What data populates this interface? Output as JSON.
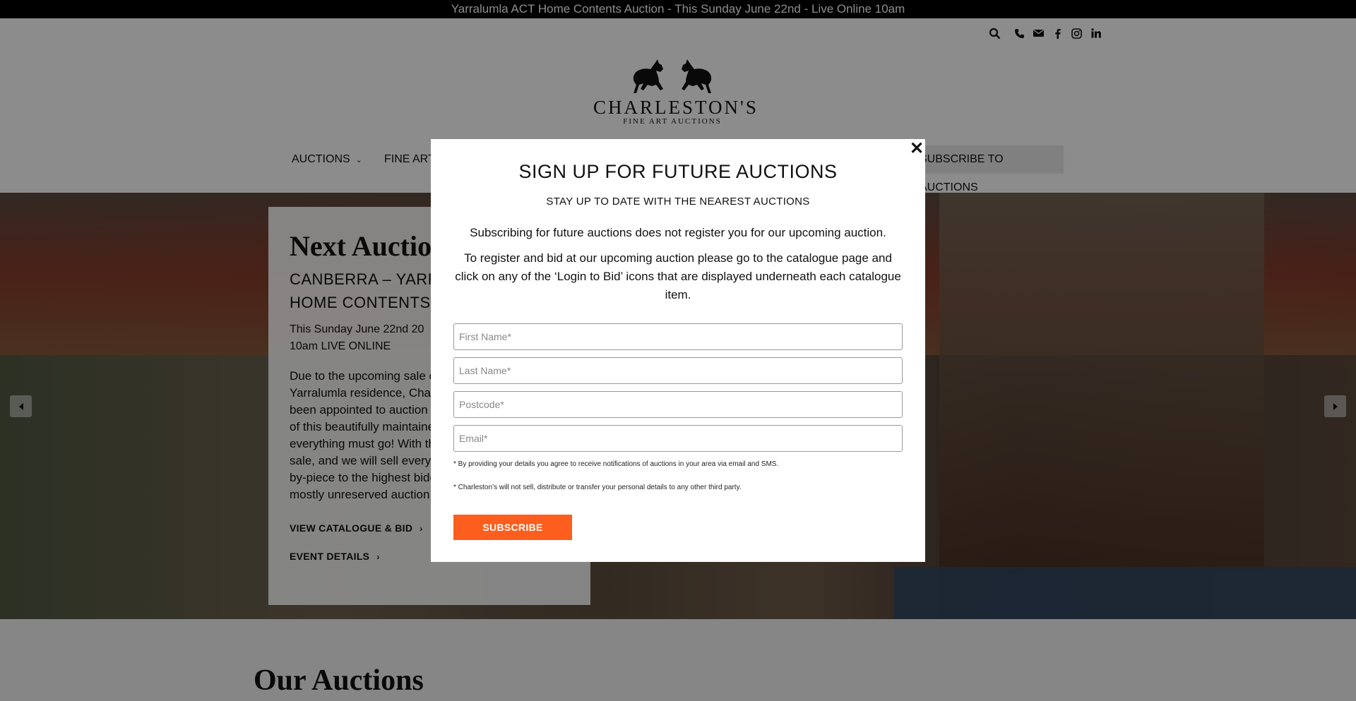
{
  "announcement": "Yarralumla ACT Home Contents Auction - This Sunday June 22nd - Live Online 10am",
  "header": {
    "icons": [
      "search-icon",
      "phone-icon",
      "email-icon",
      "facebook-icon",
      "instagram-icon",
      "linkedin-icon"
    ],
    "logo": {
      "name": "CHARLESTON'S",
      "subtitle": "FINE ART AUCTIONS"
    }
  },
  "nav": {
    "items": [
      {
        "label": "AUCTIONS",
        "has_dropdown": true
      },
      {
        "label": "FINE ART",
        "has_dropdown": false
      }
    ],
    "cta": "SUBSCRIBE TO AUCTIONS"
  },
  "hero": {
    "title": "Next Auction",
    "subtitle_line1": "CANBERRA – YARRA",
    "subtitle_line2": "HOME CONTENTS A",
    "date_line1": "This Sunday June 22nd 20",
    "date_line2": "10am LIVE ONLINE",
    "body": "Due to the upcoming sale of the Yarralumla residence, Charleston's has been appointed to auction the contents of this beautifully maintained home, and everything must go! With the home for sale, and we will sell every item piece-by-piece to the highest bidder in this mostly unreserved auction.",
    "link_catalogue": "VIEW CATALOGUE & BID",
    "link_event": "EVENT DETAILS"
  },
  "section": {
    "title": "Our Auctions"
  },
  "modal": {
    "title": "SIGN UP FOR FUTURE AUCTIONS",
    "subtitle": "STAY UP TO DATE WITH THE NEAREST AUCTIONS",
    "paragraph1": "Subscribing for future auctions does not register you for our upcoming auction.",
    "paragraph2": "To register and bid at our upcoming auction please go to the catalogue page and click on any of the ‘Login to Bid’ icons that are displayed underneath each catalogue item.",
    "fields": {
      "first_name": {
        "placeholder": "First Name*",
        "value": ""
      },
      "last_name": {
        "placeholder": "Last Name*",
        "value": ""
      },
      "postcode": {
        "placeholder": "Postcode*",
        "value": ""
      },
      "email": {
        "placeholder": "Email*",
        "value": ""
      }
    },
    "fine_print1": "* By providing your details you agree to receive notifications of auctions in your area via email and SMS.",
    "fine_print2": "* Charleston’s will not sell, distribute or transfer your personal details to any other third party.",
    "submit_label": "SUBSCRIBE",
    "close_label": "✕",
    "accent_color": "#fd5e1d"
  }
}
